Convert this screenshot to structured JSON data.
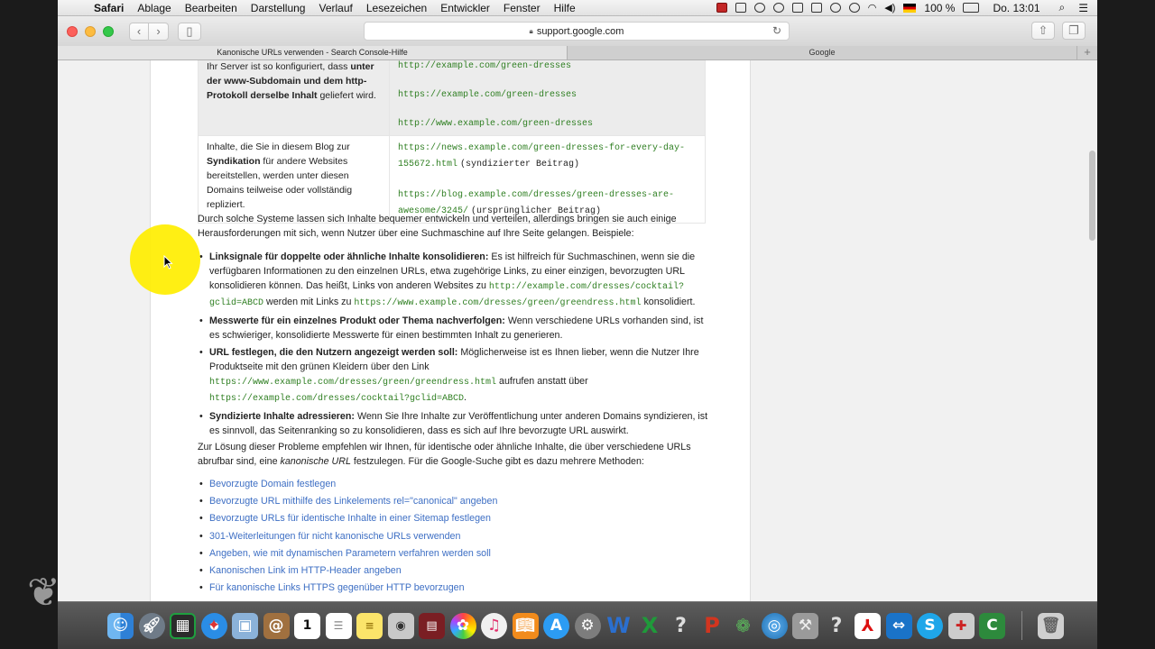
{
  "menubar": {
    "app": "Safari",
    "items": [
      "Ablage",
      "Bearbeiten",
      "Darstellung",
      "Verlauf",
      "Lesezeichen",
      "Entwickler",
      "Fenster",
      "Hilfe"
    ],
    "battery": "100 %",
    "clock": "Do. 13:01"
  },
  "toolbar": {
    "address": "support.google.com"
  },
  "tabs": [
    "Kanonische URLs verwenden - Search Console-Hilfe",
    "Google"
  ],
  "table": {
    "row1": {
      "desc_prefix": "Ihr Server ist so konfiguriert, dass ",
      "desc_bold": "unter der www-Subdomain und dem http-Protokoll derselbe Inhalt",
      "desc_suffix": " geliefert wird.",
      "urls": [
        "http://example.com/green-dresses",
        "https://example.com/green-dresses",
        "http://www.example.com/green-dresses"
      ]
    },
    "row2": {
      "desc_prefix": "Inhalte, die Sie in diesem Blog zur ",
      "desc_bold": "Syndikation",
      "desc_suffix": " für andere Websites bereitstellen, werden unter diesen Domains teilweise oder vollständig repliziert.",
      "url1": "https://news.example.com/green-dresses-for-every-day-155672.html",
      "url1_note": "(syndizierter Beitrag)",
      "url2": "https://blog.example.com/dresses/green-dresses-are-awesome/3245/",
      "url2_note": "(ursprünglicher Beitrag)"
    }
  },
  "intro": "Durch solche Systeme lassen sich Inhalte bequemer entwickeln und verteilen, allerdings bringen sie auch einige Herausforderungen mit sich, wenn Nutzer über eine Suchmaschine auf Ihre Seite gelangen. Beispiele:",
  "issues": {
    "i1": {
      "bold": "Linksignale für doppelte oder ähnliche Inhalte konsolidieren:",
      "text1": " Es ist hilfreich für Suchmaschinen, wenn sie die verfügbaren Informationen zu den einzelnen URLs, etwa zugehörige Links, zu einer einzigen, bevorzugten URL konsolidieren können. Das heißt, Links von anderen Websites zu ",
      "code1": "http://example.com/dresses/cocktail?gclid=ABCD",
      "text2": " werden mit Links zu ",
      "code2": "https://www.example.com/dresses/green/greendress.html",
      "text3": " konsolidiert."
    },
    "i2": {
      "bold": "Messwerte für ein einzelnes Produkt oder Thema nachverfolgen:",
      "text1": " Wenn verschiedene URLs vorhanden sind, ist es schwieriger, konsolidierte Messwerte für einen bestimmten Inhalt zu generieren."
    },
    "i3": {
      "bold": "URL festlegen, die den Nutzern angezeigt werden soll:",
      "text1": " Möglicherweise ist es Ihnen lieber, wenn die Nutzer Ihre Produktseite mit den grünen Kleidern über den Link ",
      "code1": "https://www.example.com/dresses/green/greendress.html",
      "text2": " aufrufen anstatt über ",
      "code2": "https://example.com/dresses/cocktail?gclid=ABCD",
      "text3": "."
    },
    "i4": {
      "bold": "Syndizierte Inhalte adressieren:",
      "text1": " Wenn Sie Ihre Inhalte zur Veröffentlichung unter anderen Domains syndizieren, ist es sinnvoll, das Seitenranking so zu konsolidieren, dass es sich auf Ihre bevorzugte URL auswirkt."
    }
  },
  "solution": {
    "text1": "Zur Lösung dieser Probleme empfehlen wir Ihnen, für identische oder ähnliche Inhalte, die über verschiedene URLs abrufbar sind, eine ",
    "italic": "kanonische URL",
    "text2": " festzulegen. Für die Google-Suche gibt es dazu mehrere Methoden:"
  },
  "methods": [
    "Bevorzugte Domain festlegen",
    "Bevorzugte URL mithilfe des Linkelements rel=\"canonical\" angeben",
    "Bevorzugte URLs für identische Inhalte in einer Sitemap festlegen",
    "301-Weiterleitungen für nicht kanonische URLs verwenden",
    "Angeben, wie mit dynamischen Parametern verfahren werden soll",
    "Kanonischen Link im HTTP-Header angeben",
    "Für kanonische Links HTTPS gegenüber HTTP bevorzugen"
  ],
  "dock": {
    "icons": [
      "finder-icon",
      "launchpad-icon",
      "mission-control-icon",
      "safari-icon",
      "preview-icon",
      "contacts-icon",
      "calendar-icon",
      "reminders-icon",
      "notes-icon",
      "photo-booth-icon",
      "photos-app-icon",
      "photos-icon",
      "itunes-icon",
      "ibooks-icon",
      "app-store-icon",
      "system-preferences-icon",
      "word-icon",
      "excel-icon",
      "help-icon",
      "powerpoint-icon",
      "messenger-icon",
      "network-icon",
      "migration-icon",
      "help2-icon",
      "acrobat-icon",
      "teamviewer-icon",
      "skype-icon",
      "utility-icon",
      "camtasia-icon",
      "trash-icon"
    ],
    "calendar_day": "1"
  }
}
